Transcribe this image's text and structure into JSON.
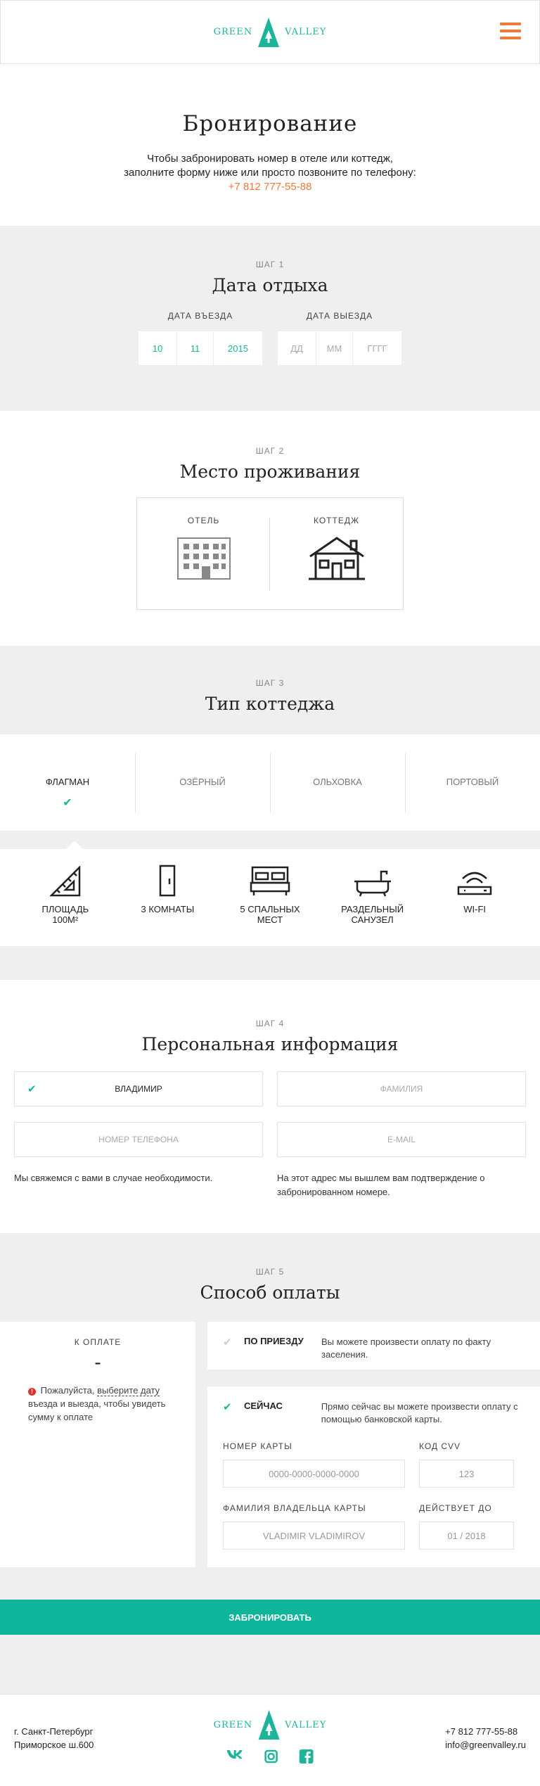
{
  "brand": {
    "left": "GREEN",
    "right": "VALLEY",
    "color": "#1cb59a",
    "accent": "#f07a3a"
  },
  "intro": {
    "title": "Бронирование",
    "text": "Чтобы забронировать номер в отеле или коттедж, заполните форму ниже или просто позвоните по телефону:",
    "phone": "+7 812 777-55-88"
  },
  "step1": {
    "label": "ШАГ 1",
    "title": "Дата отдыха",
    "checkin_label": "ДАТА ВЪЕЗДА",
    "checkin": [
      "10",
      "11",
      "2015"
    ],
    "checkout_label": "ДАТА ВЫЕЗДА",
    "checkout": [
      "ДД",
      "ММ",
      "ГГГГ"
    ]
  },
  "step2": {
    "label": "ШАГ 2",
    "title": "Место проживания",
    "options": [
      "ОТЕЛЬ",
      "КОТТЕДЖ"
    ]
  },
  "step3": {
    "label": "ШАГ 3",
    "title": "Тип коттеджа",
    "tabs": [
      "ФЛАГМАН",
      "ОЗЁРНЫЙ",
      "ОЛЬХОВКА",
      "ПОРТОВЫЙ"
    ],
    "active_tab": "ФЛАГМАН",
    "features": [
      {
        "icon": "ruler-triangle-icon",
        "line1": "ПЛОЩАДЬ",
        "line2": "100М²"
      },
      {
        "icon": "door-icon",
        "line1": "3 КОМНАТЫ",
        "line2": ""
      },
      {
        "icon": "bed-icon",
        "line1": "5 СПАЛЬНЫХ",
        "line2": "МЕСТ"
      },
      {
        "icon": "bathtub-icon",
        "line1": "РАЗДЕЛЬНЫЙ",
        "line2": "САНУЗЕЛ"
      },
      {
        "icon": "wifi-router-icon",
        "line1": "WI-FI",
        "line2": ""
      }
    ]
  },
  "step4": {
    "label": "ШАГ 4",
    "title": "Персональная информация",
    "first_name": "ВЛАДИМИР",
    "last_name_placeholder": "ФАМИЛИЯ",
    "phone_placeholder": "НОМЕР ТЕЛЕФОНА",
    "email_placeholder": "E-MAIL",
    "phone_hint": "Мы свяжемся с вами в случае необходимости.",
    "email_hint": "На этот адрес мы вышлем вам подтверждение о забронированном номере."
  },
  "step5": {
    "label": "ШАГ 5",
    "title": "Способ оплаты",
    "to_pay_label": "К ОПЛАТЕ",
    "to_pay_value": "-",
    "warn_prefix": "Пожалуйста,",
    "warn_link": "выберите дату",
    "warn_suffix": "въезда и выезда, чтобы увидеть сумму к оплате",
    "option1_name": "ПО ПРИЕЗДУ",
    "option1_desc": "Вы можете произвести оплату по факту заселения.",
    "option2_name": "СЕЙЧАС",
    "option2_desc": "Прямо сейчас вы можете произвести оплату с помощью банковской карты.",
    "card_label": "НОМЕР КАРТЫ",
    "card_placeholder": "0000-0000-0000-0000",
    "cvv_label": "КОД CVV",
    "cvv_placeholder": "123",
    "holder_label": "ФАМИЛИЯ ВЛАДЕЛЬЦА КАРТЫ",
    "holder_placeholder": "VLADIMIR VLADIMIROV",
    "expiry_label": "ДЕЙСТВУЕТ ДО",
    "expiry_placeholder": "01 / 2018"
  },
  "submit": "ЗАБРОНИРОВАТЬ",
  "footer": {
    "city": "г. Санкт-Петербург",
    "address": "Приморское ш.600",
    "phone": "+7 812 777-55-88",
    "email": "info@greenvalley.ru",
    "socials": [
      "vk-icon",
      "instagram-icon",
      "facebook-icon"
    ]
  }
}
